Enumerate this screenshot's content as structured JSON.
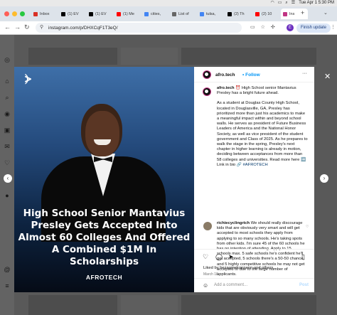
{
  "menubar": {
    "datetime": "Tue Apr 1  5:30 PM",
    "icons": [
      "wifi-icon",
      "battery-icon",
      "search-icon",
      "control-center-icon"
    ]
  },
  "tabs": [
    {
      "label": "Inbox",
      "favicon_color": "#d93025"
    },
    {
      "label": "(1) EV",
      "favicon_color": "#000000"
    },
    {
      "label": "(1) EV",
      "favicon_color": "#000000"
    },
    {
      "label": "(1) Me",
      "favicon_color": "#ff0000"
    },
    {
      "label": "cities,",
      "favicon_color": "#4285f4"
    },
    {
      "label": "List of",
      "favicon_color": "#666666"
    },
    {
      "label": "tulsa,",
      "favicon_color": "#4285f4"
    },
    {
      "label": "(2) Th",
      "favicon_color": "#000000"
    },
    {
      "label": "(2) 10",
      "favicon_color": "#ff0000"
    },
    {
      "label": "Ins",
      "favicon_color": "#c13584",
      "active": true
    }
  ],
  "address": {
    "url": "instagram.com/p/DHXCqF1T3eQ/",
    "profile_initial": "E",
    "finish_update": "Finish update"
  },
  "post": {
    "media": {
      "headline": "High School Senior Mantavius Presley Gets Accepted Into Almost 60 Colleges And Offered A Combined $1M In Scholarships",
      "brand": "AFROTECH"
    },
    "author": "afro.tech",
    "follow_label": "Follow",
    "caption_lead": "High School senior Mantavius Presley has a bright future ahead.",
    "caption_body": "As a student at Douglas County High School, located in Douglasville, GA, Presley has prioritized more than just his academics to make a meaningful impact within and beyond school walls. He serves as president of Future Business Leaders of America and the National Honor Society, as well as vice president of the student government and Class of 2025. As he prepares to walk the stage in the spring, Presley's next chapter in higher learning is already in motion, deciding between acceptances from more than 58 colleges and universities. Read more here",
    "caption_link": "Link in bio",
    "hashtag": "#AFROTECH",
    "comment": {
      "author": "richiecyclingrich",
      "text": "We should really discourage kids that are obviously very smart and will get accepted to most schools they apply from applying to so many schools. He's taking spots from other kids. I'm sure 45 of the 60 schools he has no intention of attending. Apply to 15 schools max. 5 safe schools he's confident he'll get accepted, 5 schools there's a 50-50 chance, and 5 highly competitive schools he may not get accepted to due to the large number of applicants."
    },
    "likes": "Liked by bezaamekonnenn and others",
    "date": "March 18",
    "add_comment_placeholder": "Add a comment...",
    "post_button": "Post"
  }
}
